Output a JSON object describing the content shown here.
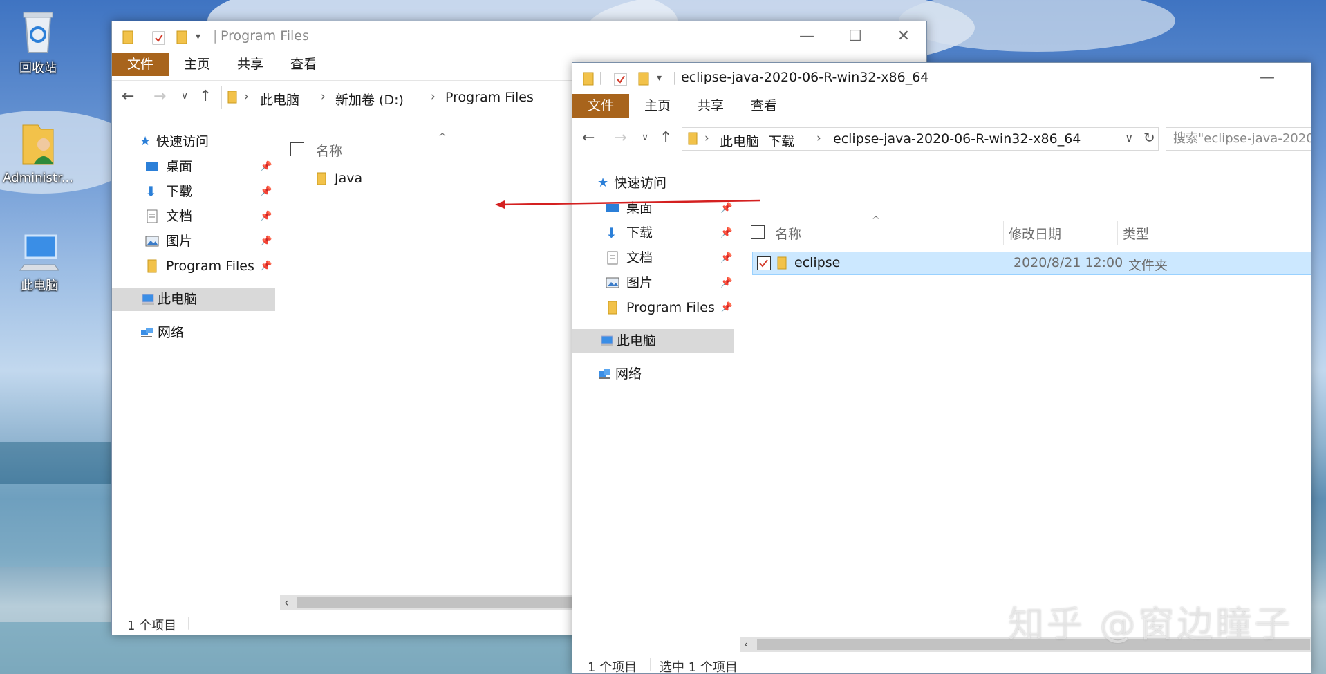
{
  "desktop": {
    "recycle_bin": "回收站",
    "admin": "Administr...",
    "this_pc": "此电脑"
  },
  "window_back": {
    "title": "Program Files",
    "tabs": [
      "文件",
      "主页",
      "共享",
      "查看"
    ],
    "breadcrumb": [
      "此电脑",
      "新加卷 (D:)",
      "Program Files"
    ],
    "nav": {
      "quick_access": "快速访问",
      "items": [
        "桌面",
        "下载",
        "文档",
        "图片",
        "Program Files"
      ],
      "this_pc": "此电脑",
      "network": "网络"
    },
    "column_name": "名称",
    "files": [
      "Java"
    ],
    "status": "1 个项目"
  },
  "window_front": {
    "title": "eclipse-java-2020-06-R-win32-x86_64",
    "tabs": [
      "文件",
      "主页",
      "共享",
      "查看"
    ],
    "breadcrumb": [
      "此电脑",
      "下载",
      "eclipse-java-2020-06-R-win32-x86_64"
    ],
    "search_placeholder": "搜索\"eclipse-java-2020",
    "nav": {
      "quick_access": "快速访问",
      "items": [
        "桌面",
        "下载",
        "文档",
        "图片",
        "Program Files"
      ],
      "this_pc": "此电脑",
      "network": "网络"
    },
    "columns": {
      "name": "名称",
      "modified": "修改日期",
      "type": "类型"
    },
    "files": [
      {
        "name": "eclipse",
        "modified": "2020/8/21 12:00",
        "type": "文件夹",
        "selected": true
      }
    ],
    "status_count": "1 个项目",
    "status_selected": "选中 1 个项目"
  },
  "watermark": "知乎 @窗边瞳子",
  "colors": {
    "file_tab": "#a8641c",
    "selection": "#cce8ff",
    "arrow": "#d42020"
  }
}
